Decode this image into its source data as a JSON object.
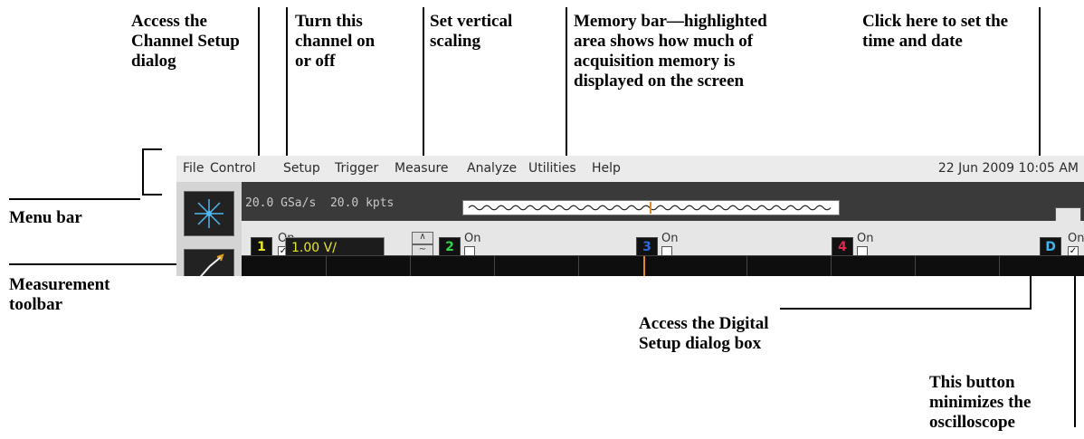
{
  "callouts": {
    "channel_setup": "Access the Channel Setup dialog",
    "on_off": "Turn this channel on or off",
    "vertical_scaling": "Set vertical scaling",
    "memory_bar": "Memory bar—highlighted area shows how much of acquisition memory is displayed on the screen",
    "time_date": "Click here to set the time and date",
    "menu_bar": "Menu bar",
    "measurement_toolbar": "Measurement toolbar",
    "digital_setup": "Access the Digital Setup dialog box",
    "minimize": "This button minimizes the oscilloscope"
  },
  "menu": {
    "items": [
      "File",
      "Control",
      "Setup",
      "Trigger",
      "Measure",
      "Analyze",
      "Utilities",
      "Help"
    ],
    "datetime": "22 Jun 2009 10:05 AM"
  },
  "acquisition": {
    "sample_rate": "20.0 GSa/s",
    "memory_depth": "20.0 kpts"
  },
  "channels": [
    {
      "label": "1",
      "color": "#e8e82a",
      "on_label": "On",
      "checked": true
    },
    {
      "label": "2",
      "color": "#2ed84a",
      "on_label": "On",
      "checked": false
    },
    {
      "label": "3",
      "color": "#2a6ce0",
      "on_label": "On",
      "checked": false
    },
    {
      "label": "4",
      "color": "#e0284a",
      "on_label": "On",
      "checked": false
    },
    {
      "label": "D",
      "color": "#1a8fd0",
      "on_label": "On",
      "checked": true
    }
  ],
  "scale": {
    "value": "1.00 V/"
  },
  "icons": [
    "hp-logo-icon",
    "measurement-icon",
    "minimize-icon",
    "scale-up-icon",
    "scale-down-icon"
  ]
}
